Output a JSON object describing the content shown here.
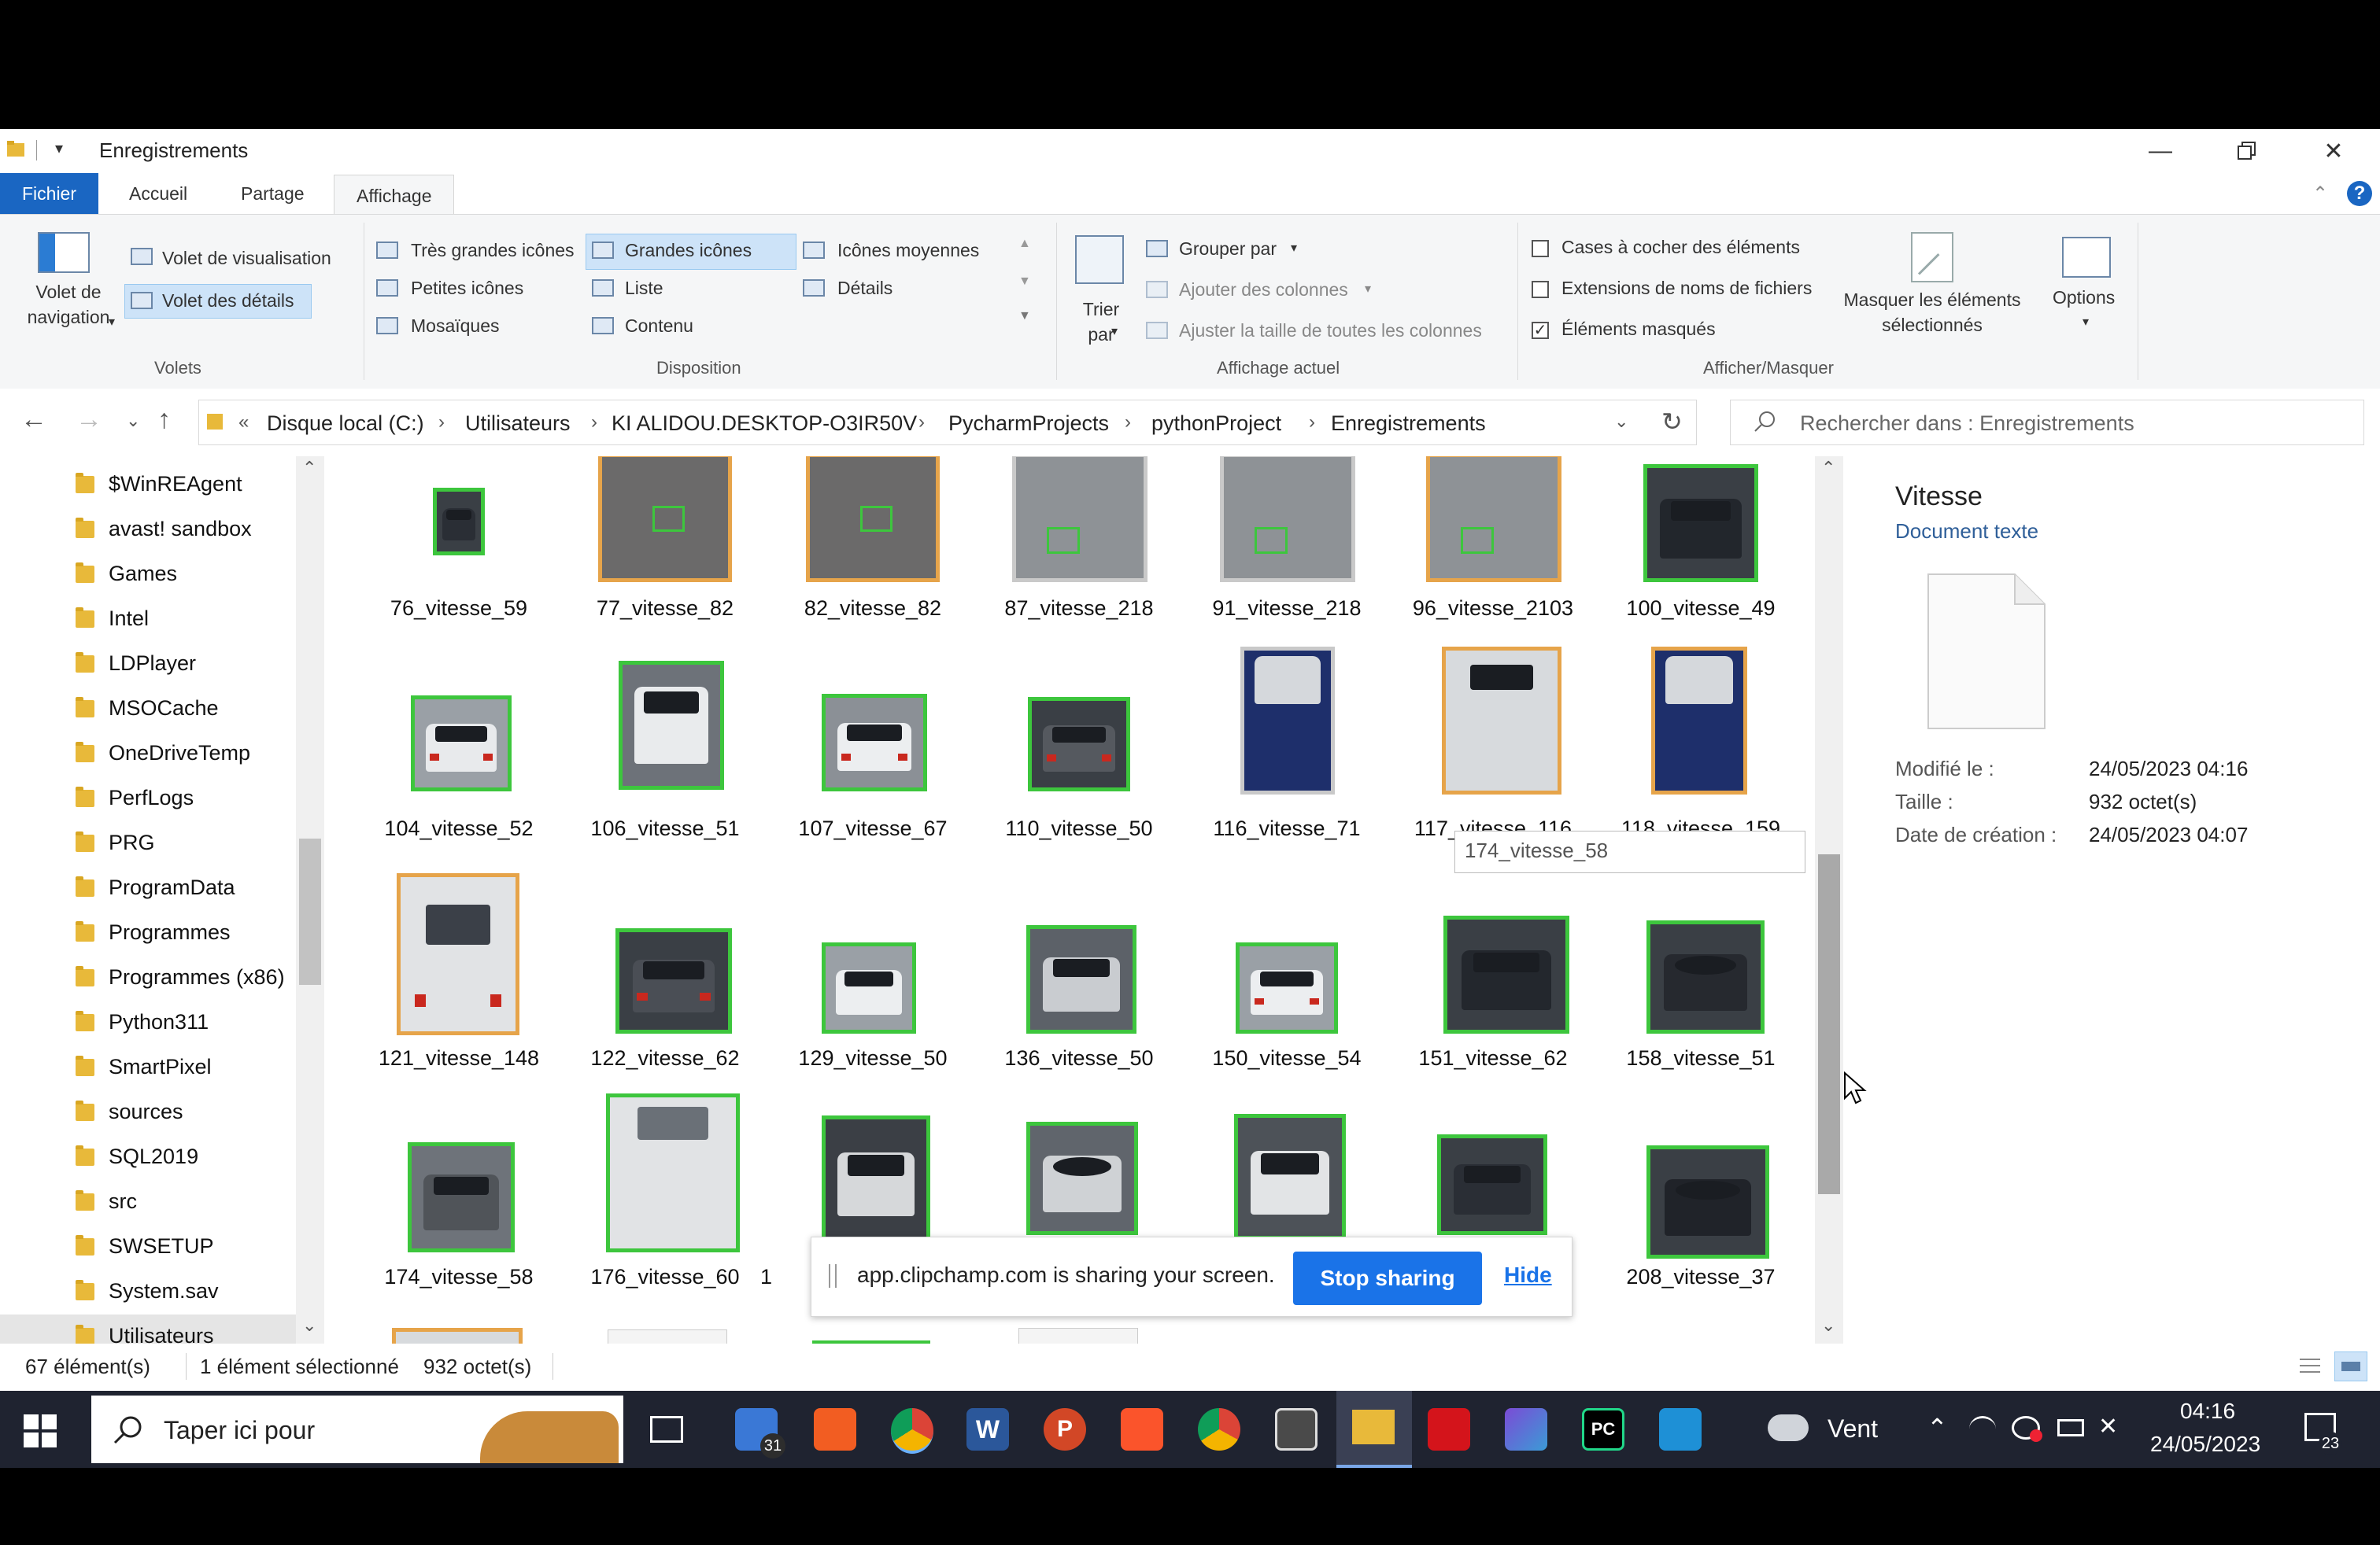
{
  "window": {
    "title": "Enregistrements"
  },
  "tabs": [
    "Fichier",
    "Accueil",
    "Partage",
    "Affichage"
  ],
  "ribbon": {
    "nav_pane": "Volet de navigation",
    "preview_pane": "Volet de visualisation",
    "details_pane": "Volet des détails",
    "group_panes": "Volets",
    "layout": [
      "Très grandes icônes",
      "Grandes icônes",
      "Icônes moyennes",
      "Petites icônes",
      "Liste",
      "Détails",
      "Mosaïques",
      "Contenu"
    ],
    "selected_layout": "Grandes icônes",
    "group_layout": "Disposition",
    "sort_by": "Trier par",
    "group_by": "Grouper par",
    "add_columns": "Ajouter des colonnes",
    "fit_columns": "Ajuster la taille de toutes les colonnes",
    "group_current_view": "Affichage actuel",
    "item_checkboxes": "Cases à cocher des éléments",
    "file_extensions": "Extensions de noms de fichiers",
    "hidden_items": "Éléments masqués",
    "hidden_items_checked": true,
    "item_checkboxes_checked": false,
    "file_extensions_checked": false,
    "hide_selected": "Masquer les éléments sélectionnés",
    "options": "Options",
    "group_show_hide": "Afficher/Masquer"
  },
  "address": {
    "crumbs": [
      "Disque local (C:)",
      "Utilisateurs",
      "KI ALIDOU.DESKTOP-O3IR50V",
      "PycharmProjects",
      "pythonProject",
      "Enregistrements"
    ],
    "overflow": "«",
    "search_placeholder": "Rechercher dans : Enregistrements"
  },
  "tree": [
    "$WinREAgent",
    "avast! sandbox",
    "Games",
    "Intel",
    "LDPlayer",
    "MSOCache",
    "OneDriveTemp",
    "PerfLogs",
    "PRG",
    "ProgramData",
    "Programmes",
    "Programmes (x86)",
    "Python311",
    "SmartPixel",
    "sources",
    "SQL2019",
    "src",
    "SWSETUP",
    "System.sav",
    "Utilisateurs"
  ],
  "files": [
    [
      "76_vitesse_59",
      "77_vitesse_82",
      "82_vitesse_82",
      "87_vitesse_218",
      "91_vitesse_218",
      "96_vitesse_2103",
      "100_vitesse_49"
    ],
    [
      "104_vitesse_52",
      "106_vitesse_51",
      "107_vitesse_67",
      "110_vitesse_50",
      "116_vitesse_71",
      "117_vitesse_116",
      "118_vitesse_159"
    ],
    [
      "121_vitesse_148",
      "122_vitesse_62",
      "129_vitesse_50",
      "136_vitesse_50",
      "150_vitesse_54",
      "151_vitesse_62",
      "158_vitesse_51"
    ],
    [
      "174_vitesse_58",
      "176_vitesse_60",
      "1",
      "",
      "",
      "",
      "208_vitesse_37"
    ]
  ],
  "tooltip": "174_vitesse_58",
  "details": {
    "name": "Vitesse",
    "type": "Document texte",
    "modified_label": "Modifié le :",
    "modified_value": "24/05/2023 04:16",
    "size_label": "Taille :",
    "size_value": "932 octet(s)",
    "created_label": "Date de création :",
    "created_value": "24/05/2023 04:07"
  },
  "status": {
    "count": "67 élément(s)",
    "selected": "1 élément sélectionné",
    "size": "932 octet(s)"
  },
  "share": {
    "message": "app.clipchamp.com is sharing your screen.",
    "stop": "Stop sharing",
    "hide": "Hide"
  },
  "taskbar": {
    "search": "Taper ici pour",
    "weather": "Vent",
    "time": "04:16",
    "date": "24/05/2023",
    "mail_badge": "31",
    "notif_badge": "23"
  },
  "colors": {
    "accent": "#1a66c2",
    "thumb_border_green": "#3dc63d",
    "thumb_border_orange": "#e6a44a",
    "taskbar": "#1f2330"
  }
}
